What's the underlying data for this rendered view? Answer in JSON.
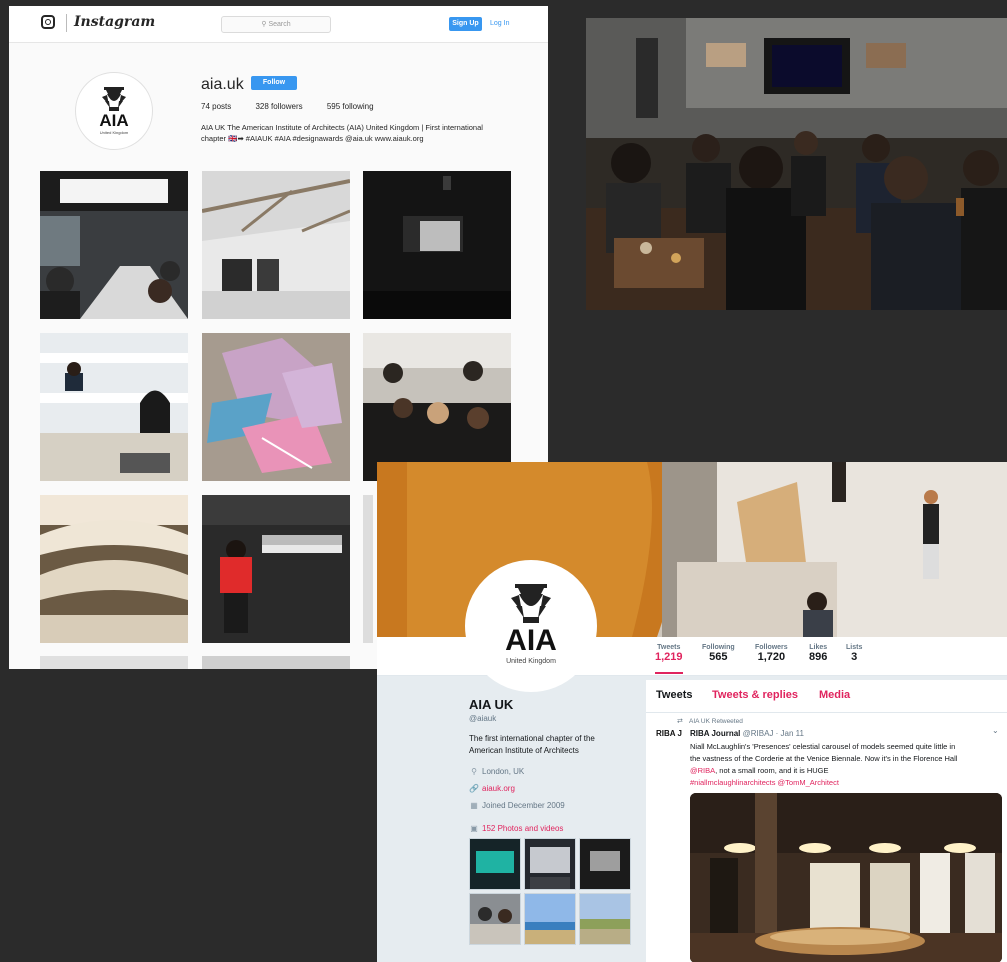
{
  "instagram": {
    "logo": "Instagram",
    "search_placeholder": "Search",
    "signup_label": "Sign Up",
    "login_label": "Log In",
    "username": "aia.uk",
    "follow_label": "Follow",
    "stats": {
      "posts": "74 posts",
      "followers": "328 followers",
      "following": "595 following"
    },
    "bio_line1": "AIA UK The American Institute of Architects (AIA) United Kingdom | First international",
    "bio_line2": "chapter 🇬🇧➡ #AIAUK #AIA #designawards @aia.uk www.aiauk.org",
    "accent": "#3897f0"
  },
  "logo_mark": {
    "letters": "AIA",
    "subtitle": "United Kingdom"
  },
  "twitter": {
    "stats": [
      {
        "label": "Tweets",
        "value": "1,219"
      },
      {
        "label": "Following",
        "value": "565"
      },
      {
        "label": "Followers",
        "value": "1,720"
      },
      {
        "label": "Likes",
        "value": "896"
      },
      {
        "label": "Lists",
        "value": "3"
      }
    ],
    "name": "AIA UK",
    "handle": "@aiauk",
    "description": "The first international chapter of the American Institute of Architects",
    "location": "London, UK",
    "website": "aiauk.org",
    "joined": "Joined December 2009",
    "photos_link": "152 Photos and videos",
    "tabs": [
      "Tweets",
      "Tweets & replies",
      "Media"
    ],
    "tweet": {
      "retweeted_by": "AIA UK Retweeted",
      "author_name": "RIBA Journal",
      "author_handle": "@RIBAJ · Jan 11",
      "avatar_text": "RIBA J",
      "text_line1": "Niall McLaughlin's 'Presences' celestial carousel of models seemed quite little in",
      "text_line2": "the vastness of the Corderie at the Venice Biennale. Now it's in the Florence Hall",
      "text_line3a": "@RIBA",
      "text_line3b": ", not a small room, and it is HUGE",
      "text_line4": "#niallmclaughlinarchitects @TomM_Architect"
    },
    "accent": "#e0245e"
  }
}
